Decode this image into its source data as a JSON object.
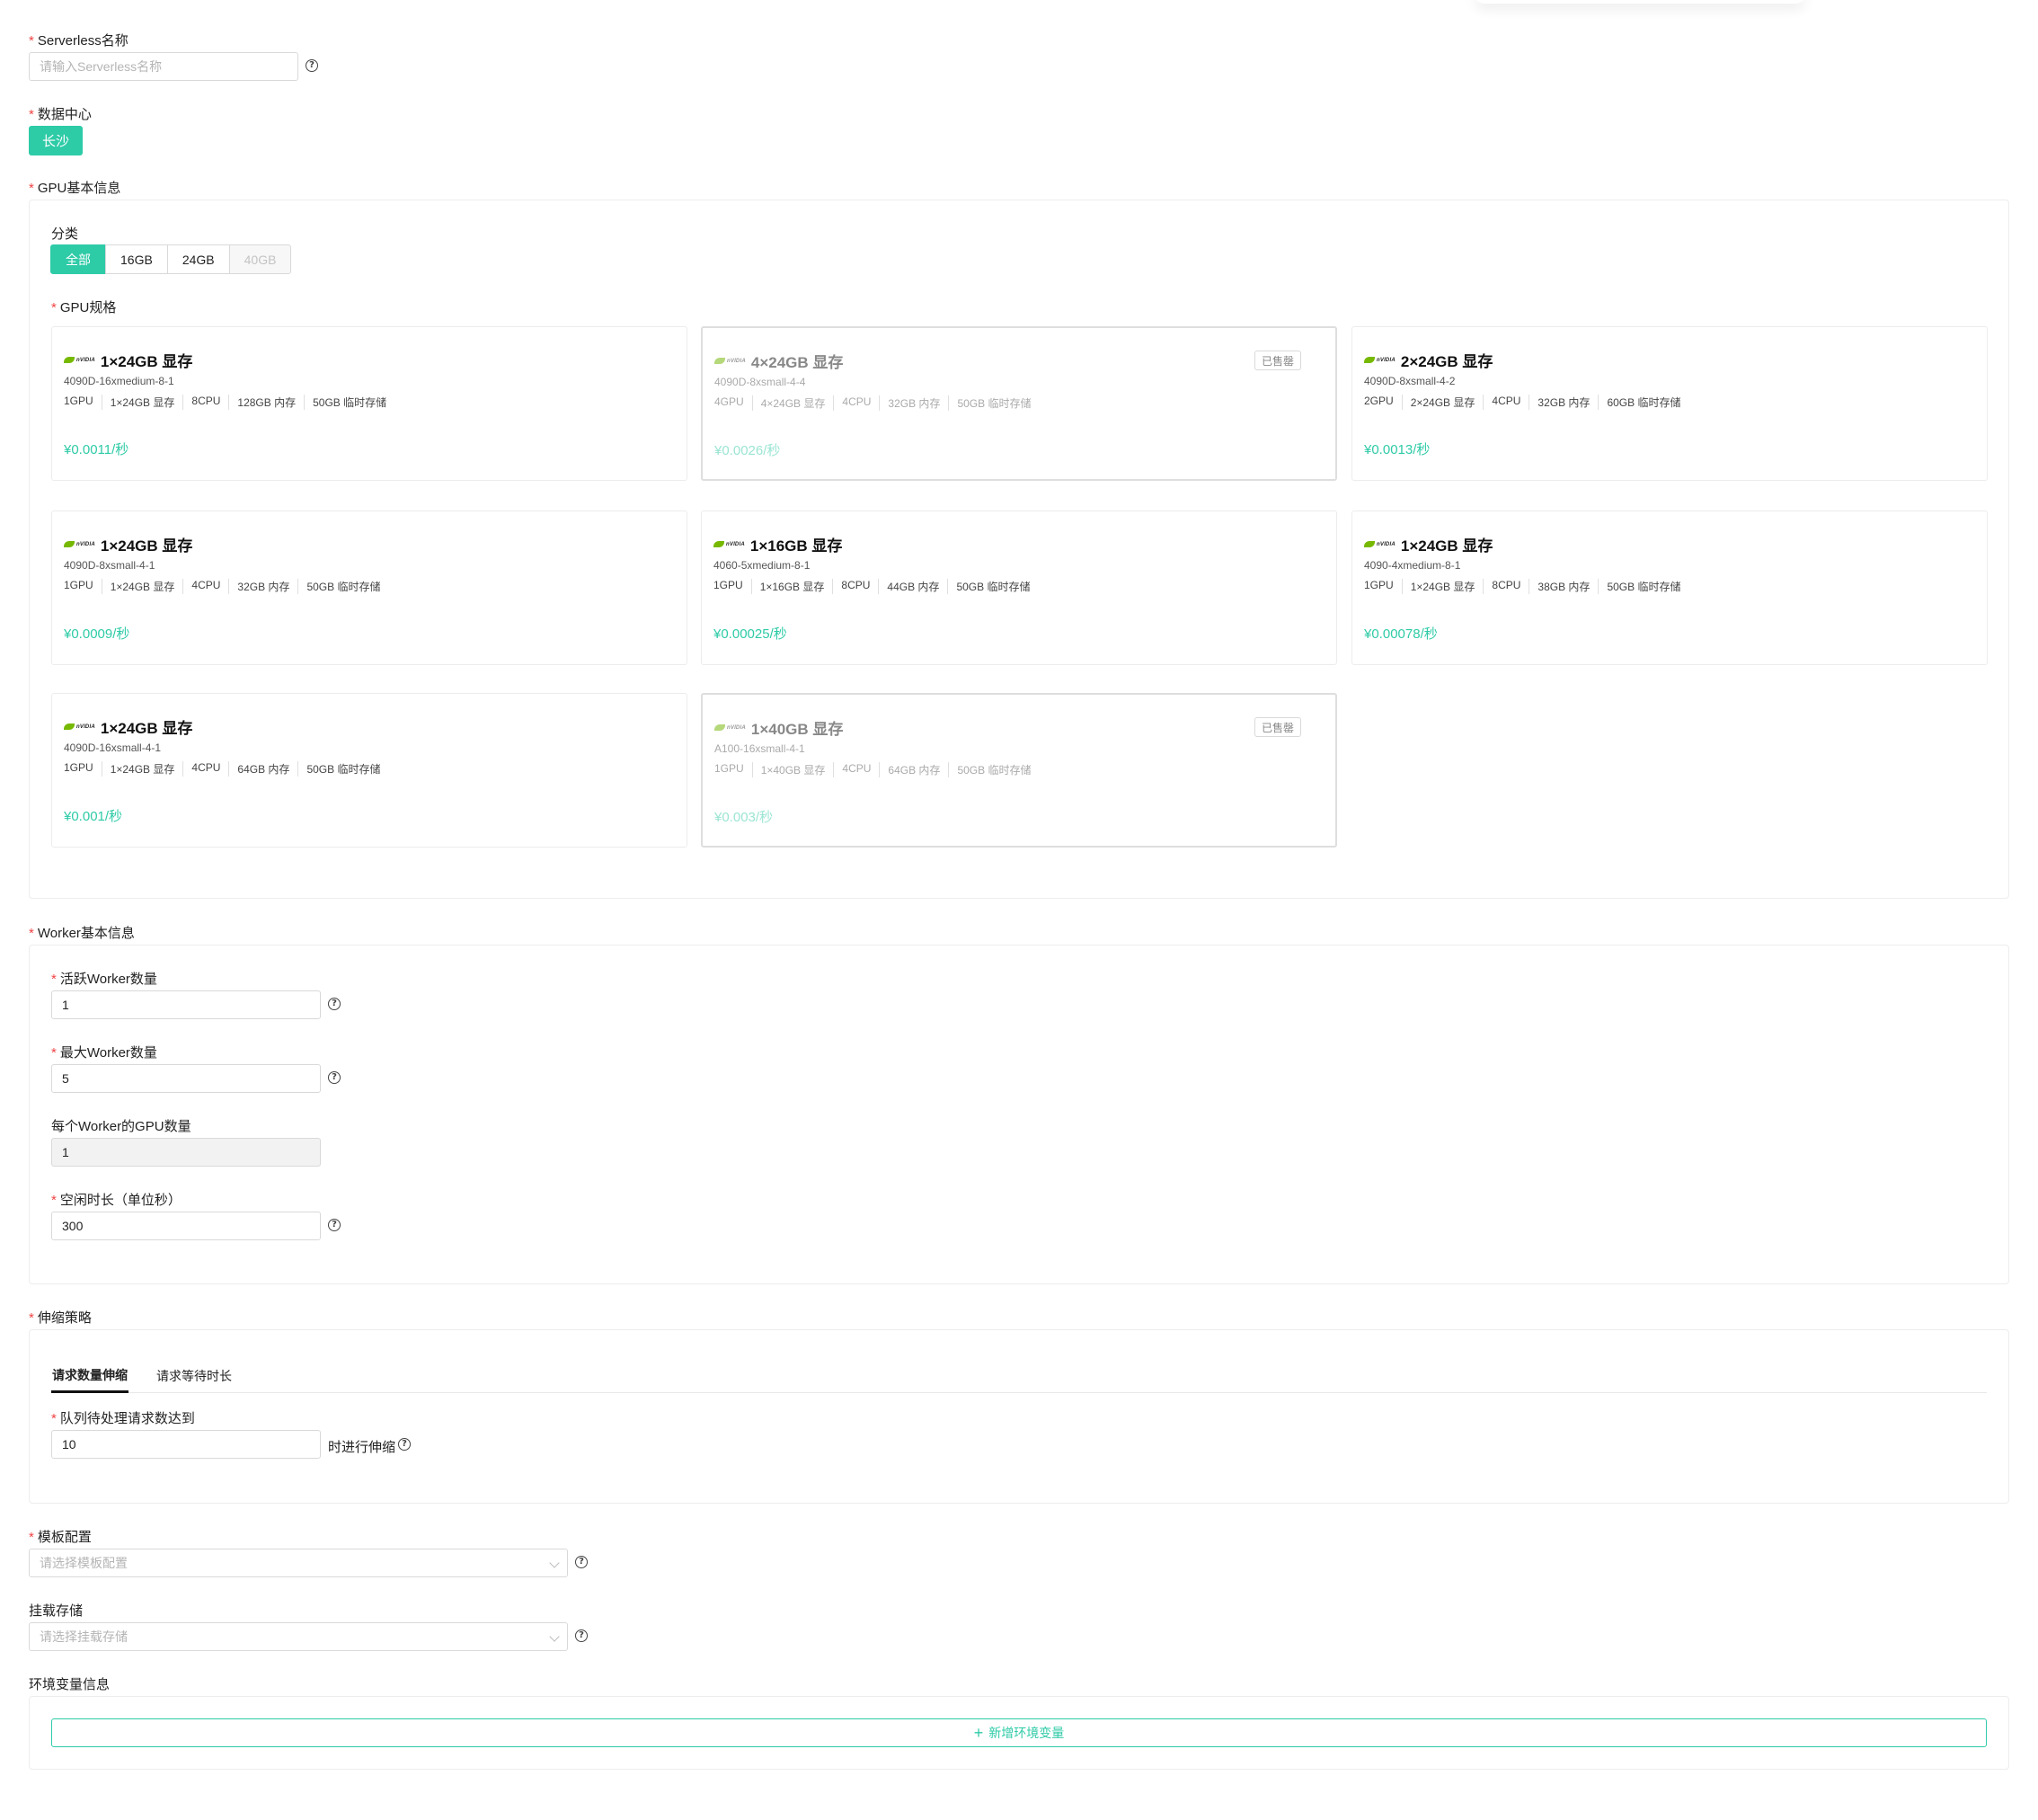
{
  "form": {
    "serverless_name": {
      "label": "Serverless名称",
      "placeholder": "请输入Serverless名称"
    },
    "datacenter": {
      "label": "数据中心",
      "selected": "长沙"
    },
    "gpu_section": {
      "label": "GPU基本信息"
    },
    "category": {
      "label": "分类",
      "options": [
        "全部",
        "16GB",
        "24GB",
        "40GB"
      ],
      "selected": "全部",
      "disabled": [
        "40GB"
      ]
    },
    "gpu_spec": {
      "label": "GPU规格",
      "vendor_logo_text": "nVIDIA",
      "sold_out_label": "已售罄",
      "cards": [
        {
          "title": "1×24GB 显存",
          "model": "4090D-16xmedium-8-1",
          "specs": [
            "1GPU",
            "1×24GB 显存",
            "8CPU",
            "128GB 内存",
            "50GB 临时存储"
          ],
          "price": "¥0.0011/秒",
          "sold_out": false
        },
        {
          "title": "4×24GB 显存",
          "model": "4090D-8xsmall-4-4",
          "specs": [
            "4GPU",
            "4×24GB 显存",
            "4CPU",
            "32GB 内存",
            "50GB 临时存储"
          ],
          "price": "¥0.0026/秒",
          "sold_out": true
        },
        {
          "title": "2×24GB 显存",
          "model": "4090D-8xsmall-4-2",
          "specs": [
            "2GPU",
            "2×24GB 显存",
            "4CPU",
            "32GB 内存",
            "60GB 临时存储"
          ],
          "price": "¥0.0013/秒",
          "sold_out": false
        },
        {
          "title": "1×24GB 显存",
          "model": "4090D-8xsmall-4-1",
          "specs": [
            "1GPU",
            "1×24GB 显存",
            "4CPU",
            "32GB 内存",
            "50GB 临时存储"
          ],
          "price": "¥0.0009/秒",
          "sold_out": false
        },
        {
          "title": "1×16GB 显存",
          "model": "4060-5xmedium-8-1",
          "specs": [
            "1GPU",
            "1×16GB 显存",
            "8CPU",
            "44GB 内存",
            "50GB 临时存储"
          ],
          "price": "¥0.00025/秒",
          "sold_out": false
        },
        {
          "title": "1×24GB 显存",
          "model": "4090-4xmedium-8-1",
          "specs": [
            "1GPU",
            "1×24GB 显存",
            "8CPU",
            "38GB 内存",
            "50GB 临时存储"
          ],
          "price": "¥0.00078/秒",
          "sold_out": false
        },
        {
          "title": "1×24GB 显存",
          "model": "4090D-16xsmall-4-1",
          "specs": [
            "1GPU",
            "1×24GB 显存",
            "4CPU",
            "64GB 内存",
            "50GB 临时存储"
          ],
          "price": "¥0.001/秒",
          "sold_out": false
        },
        {
          "title": "1×40GB 显存",
          "model": "A100-16xsmall-4-1",
          "specs": [
            "1GPU",
            "1×40GB 显存",
            "4CPU",
            "64GB 内存",
            "50GB 临时存储"
          ],
          "price": "¥0.003/秒",
          "sold_out": true
        }
      ]
    },
    "worker_section": {
      "label": "Worker基本信息"
    },
    "active_workers": {
      "label": "活跃Worker数量",
      "value": "1"
    },
    "max_workers": {
      "label": "最大Worker数量",
      "value": "5"
    },
    "gpu_per_worker": {
      "label": "每个Worker的GPU数量",
      "value": "1"
    },
    "idle_duration": {
      "label": "空闲时长（单位秒）",
      "value": "300"
    },
    "scaling": {
      "label": "伸缩策略",
      "tabs": [
        "请求数量伸缩",
        "请求等待时长"
      ],
      "active_tab": "请求数量伸缩",
      "queue_label": "队列待处理请求数达到",
      "queue_value": "10",
      "queue_suffix": "时进行伸缩"
    },
    "template": {
      "label": "模板配置",
      "placeholder": "请选择模板配置"
    },
    "storage": {
      "label": "挂载存储",
      "placeholder": "请选择挂载存储"
    },
    "env": {
      "label": "环境变量信息",
      "add_button": "新增环境变量"
    },
    "help_icon_glyph": "?"
  }
}
